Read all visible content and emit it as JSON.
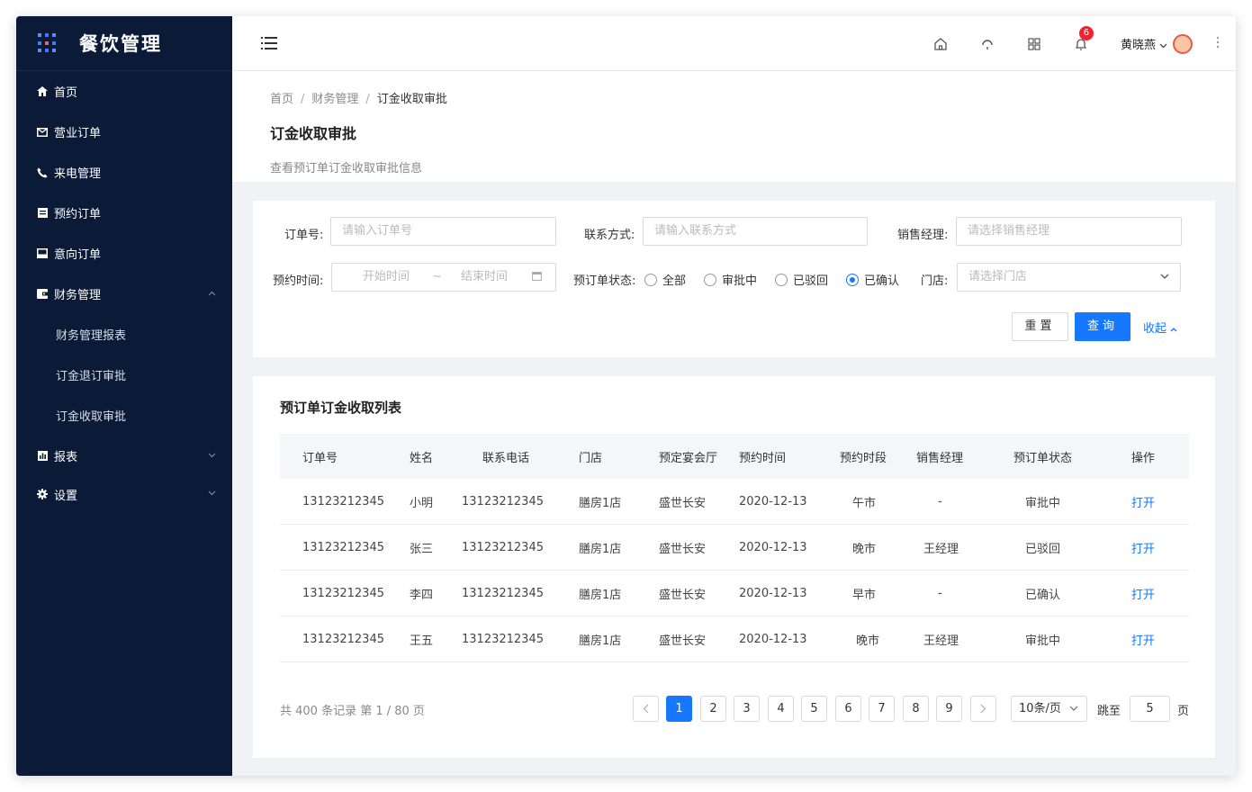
{
  "app": {
    "title": "餐饮管理"
  },
  "sidebar": {
    "items": [
      {
        "label": "首页",
        "icon": "home-icon"
      },
      {
        "label": "营业订单",
        "icon": "mail-icon"
      },
      {
        "label": "来电管理",
        "icon": "phone-icon"
      },
      {
        "label": "预约订单",
        "icon": "list-icon"
      },
      {
        "label": "意向订单",
        "icon": "inbox-icon"
      },
      {
        "label": "财务管理",
        "icon": "wallet-icon",
        "expanded": true
      },
      {
        "label": "报表",
        "icon": "chart-icon"
      },
      {
        "label": "设置",
        "icon": "gear-icon"
      }
    ],
    "finance_sub": [
      "财务管理报表",
      "订金退订审批",
      "订金收取审批"
    ]
  },
  "topbar": {
    "notification_count": "6",
    "user_name": "黄晓燕"
  },
  "breadcrumb": {
    "home": "首页",
    "section": "财务管理",
    "current": "订金收取审批"
  },
  "page": {
    "title": "订金收取审批",
    "description": "查看预订单订金收取审批信息"
  },
  "filters": {
    "order_no_label": "订单号:",
    "order_no_placeholder": "请输入订单号",
    "contact_label": "联系方式:",
    "contact_placeholder": "请输入联系方式",
    "manager_label": "销售经理:",
    "manager_placeholder": "请选择销售经理",
    "time_label": "预约时间:",
    "start_placeholder": "开始时间",
    "range_sep": "~",
    "end_placeholder": "结束时间",
    "status_label": "预订单状态:",
    "status_options": [
      "全部",
      "审批中",
      "已驳回",
      "已确认"
    ],
    "status_selected": "已确认",
    "store_label": "门店:",
    "store_placeholder": "请选择门店",
    "reset_label": "重置",
    "query_label": "查询",
    "collapse_label": "收起"
  },
  "table": {
    "title": "预订单订金收取列表",
    "columns": [
      "订单号",
      "姓名",
      "联系电话",
      "门店",
      "预定宴会厅",
      "预约时间",
      "预约时段",
      "销售经理",
      "预订单状态",
      "操作"
    ],
    "rows": [
      [
        "13123212345",
        "小明",
        "13123212345",
        "膳房1店",
        "盛世长安",
        "2020-12-13",
        "午市",
        "-",
        "审批中",
        "打开"
      ],
      [
        "13123212345",
        "张三",
        "13123212345",
        "膳房1店",
        "盛世长安",
        "2020-12-13",
        "晚市",
        "王经理",
        "已驳回",
        "打开"
      ],
      [
        "13123212345",
        "李四",
        "13123212345",
        "膳房1店",
        "盛世长安",
        "2020-12-13",
        "早市",
        "-",
        "已确认",
        "打开"
      ],
      [
        "13123212345",
        "王五",
        "13123212345",
        "膳房1店",
        "盛世长安",
        "2020-12-13",
        "晚市",
        "王经理",
        "审批中",
        "打开"
      ]
    ]
  },
  "pagination": {
    "summary": "共 400 条记录 第 1 / 80 页",
    "pages": [
      "1",
      "2",
      "3",
      "4",
      "5",
      "6",
      "7",
      "8",
      "9"
    ],
    "current": "1",
    "page_size": "10条/页",
    "jump_label": "跳至",
    "jump_value": "5",
    "page_suffix": "页"
  },
  "colors": {
    "sidebar_bg": "#0b1a36",
    "primary": "#1677ff",
    "badge": "#f5222d"
  }
}
